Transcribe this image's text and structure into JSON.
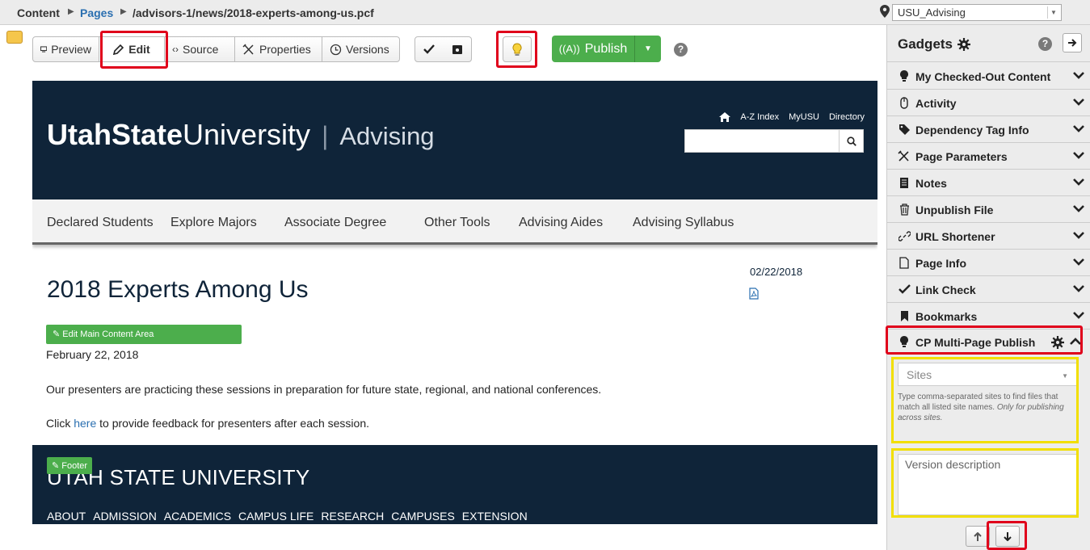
{
  "breadcrumb": {
    "root": "Content",
    "section": "Pages",
    "path": "/advisors-1/news/2018-experts-among-us.pcf"
  },
  "site_selector": {
    "value": "USU_Advising"
  },
  "toolbar": {
    "preview": "Preview",
    "edit": "Edit",
    "source": "Source",
    "properties": "Properties",
    "versions": "Versions",
    "publish": "Publish"
  },
  "site": {
    "logo_bold": "UtahState",
    "logo_light": "University",
    "logo_sub": "Advising",
    "util_links": [
      "A-Z Index",
      "MyUSU",
      "Directory"
    ],
    "nav": [
      "Declared Students",
      "Explore Majors",
      "Associate Degree",
      "Other Tools",
      "Advising Aides",
      "Advising Syllabus"
    ],
    "side_date": "02/22/2018",
    "title": "2018 Experts Among Us",
    "edit_area_label": "Edit Main Content Area",
    "date": "February 22, 2018",
    "paragraph": "Our presenters are practicing these sessions in preparation for future state, regional, and national conferences.",
    "feedback_pre": "Click ",
    "feedback_link": "here",
    "feedback_post": " to provide feedback for presenters after each session.",
    "footer_button": "Footer",
    "footer_title": "UTAH STATE UNIVERSITY",
    "footer_links": [
      "ABOUT",
      "ADMISSION",
      "ACADEMICS",
      "CAMPUS LIFE",
      "RESEARCH",
      "CAMPUSES",
      "EXTENSION"
    ]
  },
  "gadgets": {
    "title": "Gadgets",
    "items": [
      {
        "label": "My Checked-Out Content",
        "icon": "lightbulb-icon"
      },
      {
        "label": "Activity",
        "icon": "mouse-icon"
      },
      {
        "label": "Dependency Tag Info",
        "icon": "tag-icon"
      },
      {
        "label": "Page Parameters",
        "icon": "tools-icon"
      },
      {
        "label": "Notes",
        "icon": "notes-icon"
      },
      {
        "label": "Unpublish File",
        "icon": "trash-icon"
      },
      {
        "label": "URL Shortener",
        "icon": "link-icon"
      },
      {
        "label": "Page Info",
        "icon": "file-icon"
      },
      {
        "label": "Link Check",
        "icon": "check-icon"
      },
      {
        "label": "Bookmarks",
        "icon": "bookmark-icon"
      },
      {
        "label": "CP Multi-Page Publish",
        "icon": "lightbulb-icon"
      }
    ],
    "sites_placeholder": "Sites",
    "sites_help": "Type comma-separated sites to find files that match all listed site names.",
    "sites_help_italic": "Only for publishing across sites.",
    "version_placeholder": "Version description"
  },
  "colors": {
    "brand_navy": "#0f2439",
    "publish_green": "#4cae4c",
    "highlight_red": "#e0001b",
    "highlight_yellow": "#f2df00",
    "link_blue": "#2a6fb0"
  }
}
